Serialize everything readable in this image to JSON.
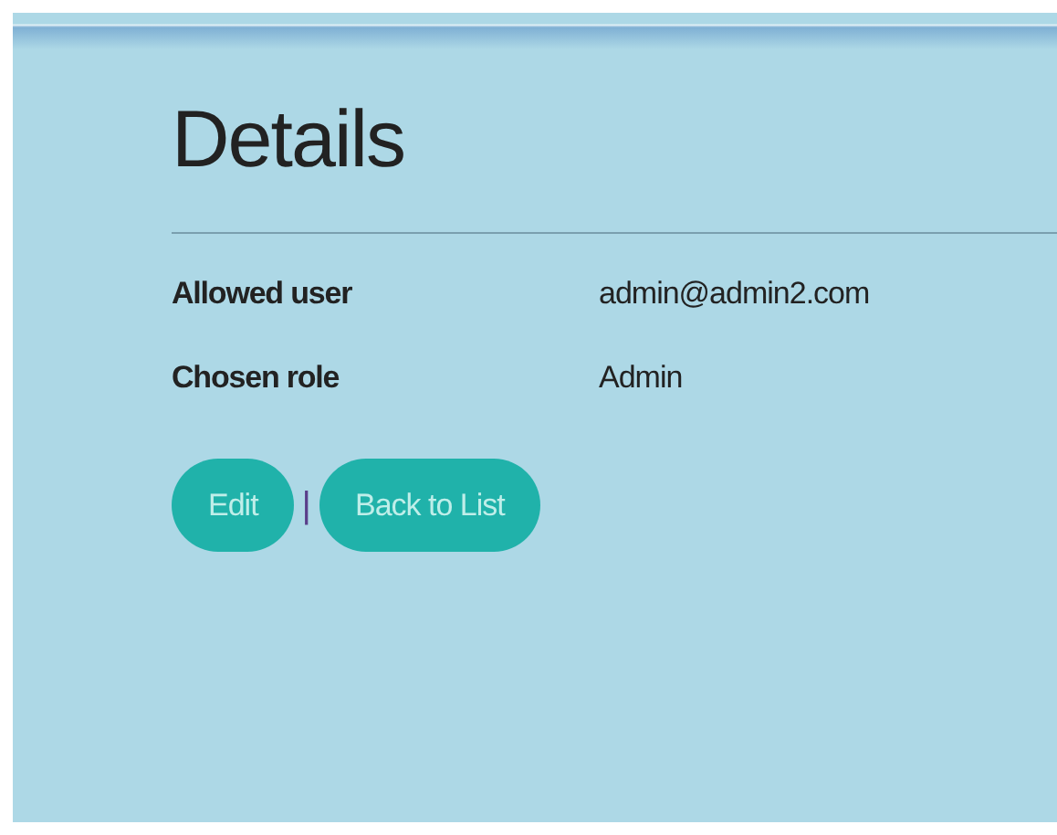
{
  "heading": "Details",
  "fields": [
    {
      "label": "Allowed user",
      "value": "admin@admin2.com"
    },
    {
      "label": "Chosen role",
      "value": "Admin"
    }
  ],
  "actions": {
    "buttons": [
      "Edit",
      "Back to List"
    ],
    "separator": "|"
  }
}
